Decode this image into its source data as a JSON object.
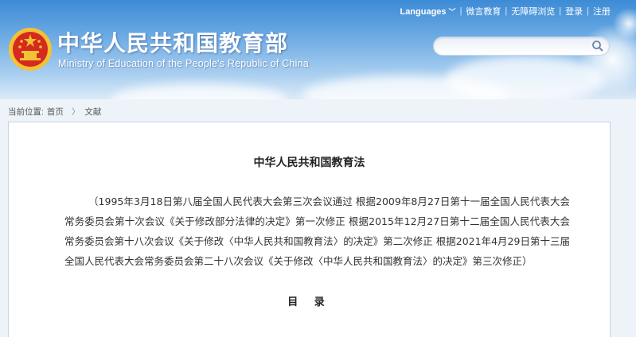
{
  "header": {
    "title_cn": "中华人民共和国教育部",
    "title_en": "Ministry of Education of the People's Republic of China",
    "emblem_icon": "national-emblem-icon"
  },
  "topbar": {
    "languages": "Languages",
    "weibo": "微言教育",
    "accessible": "无障碍浏览",
    "login": "登录",
    "register": "注册"
  },
  "search": {
    "placeholder": "",
    "icon": "search-icon"
  },
  "breadcrumb": {
    "prefix": "当前位置:",
    "home": "首页",
    "separator": "〉",
    "current": "文献"
  },
  "document": {
    "title": "中华人民共和国教育法",
    "intro": "（1995年3月18日第八届全国人民代表大会第三次会议通过 根据2009年8月27日第十一届全国人民代表大会常务委员会第十次会议《关于修改部分法律的决定》第一次修正 根据2015年12月27日第十二届全国人民代表大会常务委员会第十八次会议《关于修改〈中华人民共和国教育法〉的决定》第二次修正 根据2021年4月29日第十三届全国人民代表大会常务委员会第二十八次会议《关于修改〈中华人民共和国教育法〉的决定》第三次修正）",
    "toc_title": "目 录"
  },
  "colors": {
    "header_sky": "#3d8bd6",
    "emblem_red": "#d42a20",
    "emblem_gold": "#f3c233",
    "page_bg": "#eef3f9"
  }
}
